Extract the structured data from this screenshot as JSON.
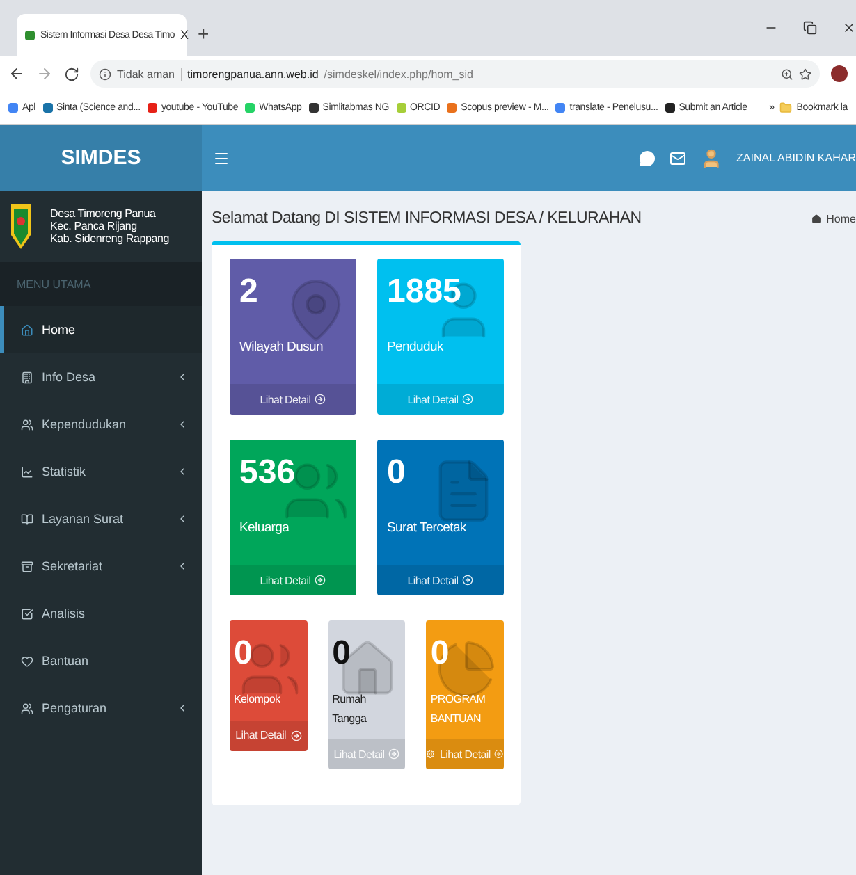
{
  "browser": {
    "tab_title": "Sistem Informasi Desa Desa Timo",
    "tab_close": "X",
    "new_tab": "+",
    "security": "Tidak aman",
    "url_host": "timorengpanua.ann.web.id",
    "url_path": "/simdeskel/index.php/hom_sid",
    "bookmarks": [
      {
        "label": "Apl",
        "color": "#4285f4"
      },
      {
        "label": "Sinta (Science and...",
        "color": "#1a73a8"
      },
      {
        "label": "youtube - YouTube",
        "color": "#e62117"
      },
      {
        "label": "WhatsApp",
        "color": "#25d366"
      },
      {
        "label": "Simlitabmas NG",
        "color": "#333333"
      },
      {
        "label": "ORCID",
        "color": "#a6ce39"
      },
      {
        "label": "Scopus preview - M...",
        "color": "#e9711c"
      },
      {
        "label": "translate - Penelusu...",
        "color": "#4285f4"
      },
      {
        "label": "Submit an Article",
        "color": "#222222"
      }
    ],
    "bookmarks_more": "»",
    "bookmark_folder": "Bookmark la"
  },
  "app": {
    "brand": "SIMDES",
    "user_name": "ZAINAL ABIDIN KAHAR",
    "village": [
      "Desa Timoreng Panua",
      "Kec. Panca Rijang",
      "Kab. Sidenreng Rappang"
    ],
    "menu_header": "MENU UTAMA",
    "menu": [
      {
        "label": "Home",
        "selected": true,
        "submenu": false
      },
      {
        "label": "Info Desa",
        "selected": false,
        "submenu": true
      },
      {
        "label": "Kependudukan",
        "selected": false,
        "submenu": true
      },
      {
        "label": "Statistik",
        "selected": false,
        "submenu": true
      },
      {
        "label": "Layanan Surat",
        "selected": false,
        "submenu": true
      },
      {
        "label": "Sekretariat",
        "selected": false,
        "submenu": true
      },
      {
        "label": "Analisis",
        "selected": false,
        "submenu": false
      },
      {
        "label": "Bantuan",
        "selected": false,
        "submenu": false
      },
      {
        "label": "Pengaturan",
        "selected": false,
        "submenu": true
      }
    ],
    "page_title": "Selamat Datang DI SISTEM INFORMASI DESA / KELURAHAN",
    "breadcrumb": "Home",
    "tile_rows": [
      [
        {
          "value": "2",
          "label": "Wilayah Dusun",
          "link": "Lihat Detail",
          "color": "#605ca8",
          "extra_icon": false
        },
        {
          "value": "1885",
          "label": "Penduduk",
          "link": "Lihat Detail",
          "color": "#00c0ef",
          "extra_icon": false
        }
      ],
      [
        {
          "value": "536",
          "label": "Keluarga",
          "link": "Lihat Detail",
          "color": "#00a65a",
          "extra_icon": false
        },
        {
          "value": "0",
          "label": "Surat Tercetak",
          "link": "Lihat Detail",
          "color": "#0073b7",
          "extra_icon": false
        }
      ],
      [
        {
          "value": "0",
          "label": "Kelompok",
          "link": "Lihat Detail",
          "color": "#dd4b39",
          "extra_icon": false
        },
        {
          "value": "0",
          "label": "Rumah Tangga",
          "link": "Lihat Detail",
          "color": "#d2d6de",
          "extra_icon": false
        },
        {
          "value": "0",
          "label": "PROGRAM BANTUAN",
          "link": "Lihat Detail",
          "color": "#f39c12",
          "extra_icon": true
        }
      ]
    ]
  }
}
